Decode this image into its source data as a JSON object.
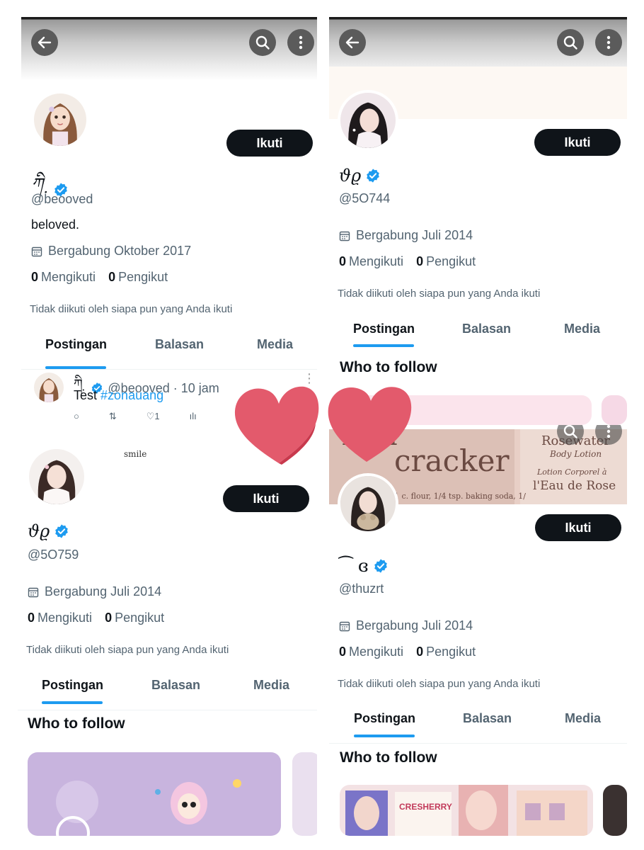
{
  "common": {
    "follow_label": "Ikuti",
    "not_followed_text": "Tidak diikuti oleh siapa pun yang Anda ikuti",
    "following_label": "Mengikuti",
    "followers_label": "Pengikut",
    "who_to_follow": "Who to follow",
    "tabs": [
      "Postingan",
      "Balasan",
      "Media"
    ]
  },
  "profile1": {
    "name": "ཀི ̣",
    "handle": "@beooved",
    "bio": "beloved.",
    "joined": "Bergabung Oktober 2017",
    "following_count": "0",
    "followers_count": "0"
  },
  "tweet1": {
    "author": "ཀི ̣",
    "handle_time": "@beooved · 10 jam",
    "text": "Test",
    "hashtag": "#zonauang",
    "like_count": "1"
  },
  "profile2": {
    "name": "ϑϱ",
    "handle": "@5O744",
    "joined": "Bergabung Juli 2014",
    "following_count": "0",
    "followers_count": "0"
  },
  "profile3": {
    "small_text": "smile",
    "name": "ϑϱ",
    "handle": "@5O759",
    "joined": "Bergabung Juli 2014",
    "following_count": "0",
    "followers_count": "0"
  },
  "profile4": {
    "banner_text_1": "imal",
    "banner_text_2": "cracker",
    "banner_text_3": "Rosewater",
    "banner_text_4": "Body Lotion",
    "banner_text_5": "Lotion Corporel à",
    "banner_text_6": "l'Eau de Rose",
    "banner_text_7": "1 c. flour, 1/4 tsp. baking soda, 1/",
    "name": "⁀ ɞ",
    "handle": "@thuzrt",
    "joined": "Bergabung Juli 2014",
    "following_count": "0",
    "followers_count": "0"
  },
  "cards": {
    "card_text_1": "CRESHERRY"
  },
  "colors": {
    "verified": "#1d9bf0",
    "heart": "#e35a6c",
    "accent": "#1d9bf0",
    "text": "#0f1419",
    "muted": "#536471"
  }
}
